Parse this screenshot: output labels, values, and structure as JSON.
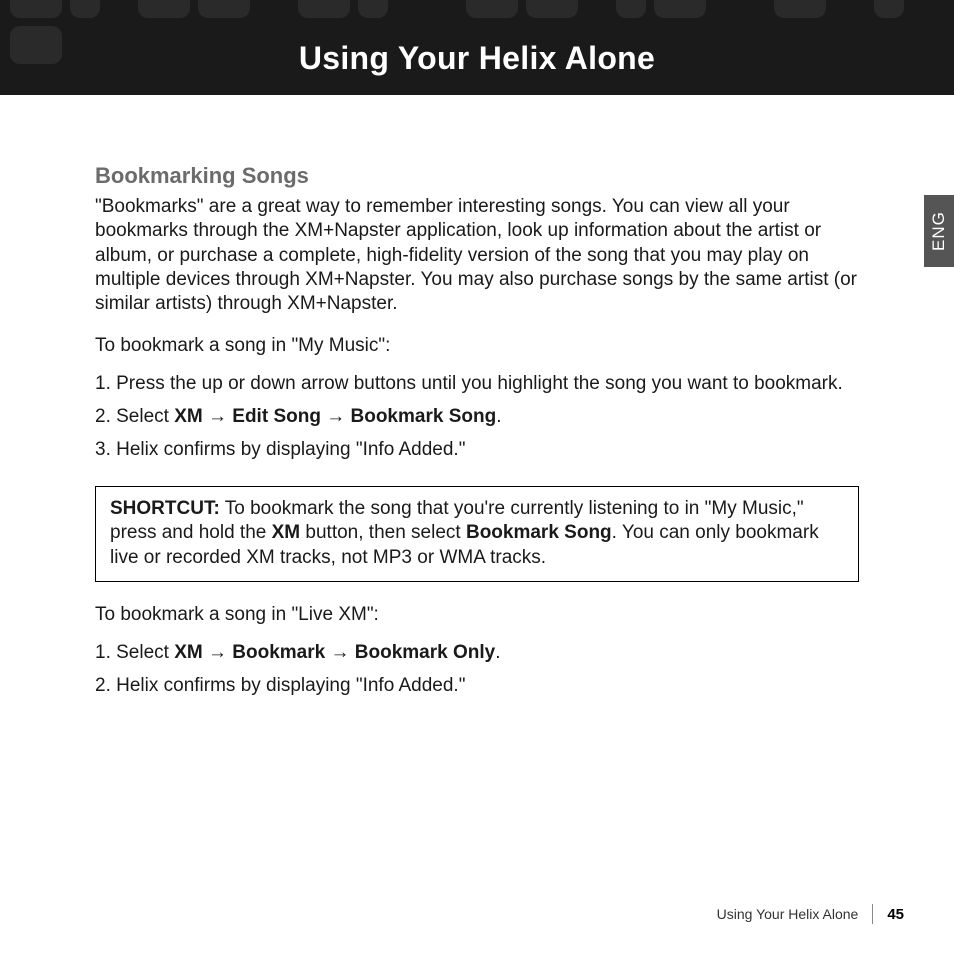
{
  "header": {
    "title": "Using Your Helix Alone"
  },
  "langTab": "ENG",
  "section": {
    "heading": "Bookmarking Songs",
    "intro": "\"Bookmarks\" are a great way to remember interesting songs. You can view all your bookmarks through the XM+Napster application, look up information about the artist or album, or purchase a complete, high-fidelity version of the song that you may play on multiple devices through XM+Napster. You may also purchase songs by the same artist (or similar artists) through XM+Napster.",
    "lead1": "To bookmark a song in \"My Music\":",
    "steps1": {
      "s1": "1. Press the up or down arrow buttons until you highlight the song you want to bookmark.",
      "s2_prefix": "2. Select ",
      "s2_xm": "XM",
      "s2_arrow": " → ",
      "s2_edit": "Edit Song",
      "s2_bookmark": "Bookmark Song",
      "s2_period": ".",
      "s3": "3. Helix confirms by displaying \"Info Added.\""
    },
    "shortcut": {
      "label": "SHORTCUT:",
      "text1": " To bookmark the song that you're currently listening to in \"My Music,\" press and hold the ",
      "xm": "XM",
      "text2": " button, then select ",
      "bookmark": "Bookmark Song",
      "text3": ". You can only bookmark live or recorded XM tracks, not MP3 or WMA tracks."
    },
    "lead2": "To bookmark a song in \"Live XM\":",
    "steps2": {
      "s1_prefix": "1. Select ",
      "s1_xm": "XM",
      "s1_arrow": " → ",
      "s1_bookmark": "Bookmark",
      "s1_only": "Bookmark Only",
      "s1_period": ".",
      "s2": "2. Helix confirms by displaying \"Info Added.\""
    }
  },
  "footer": {
    "title": "Using Your Helix Alone",
    "page": "45"
  }
}
